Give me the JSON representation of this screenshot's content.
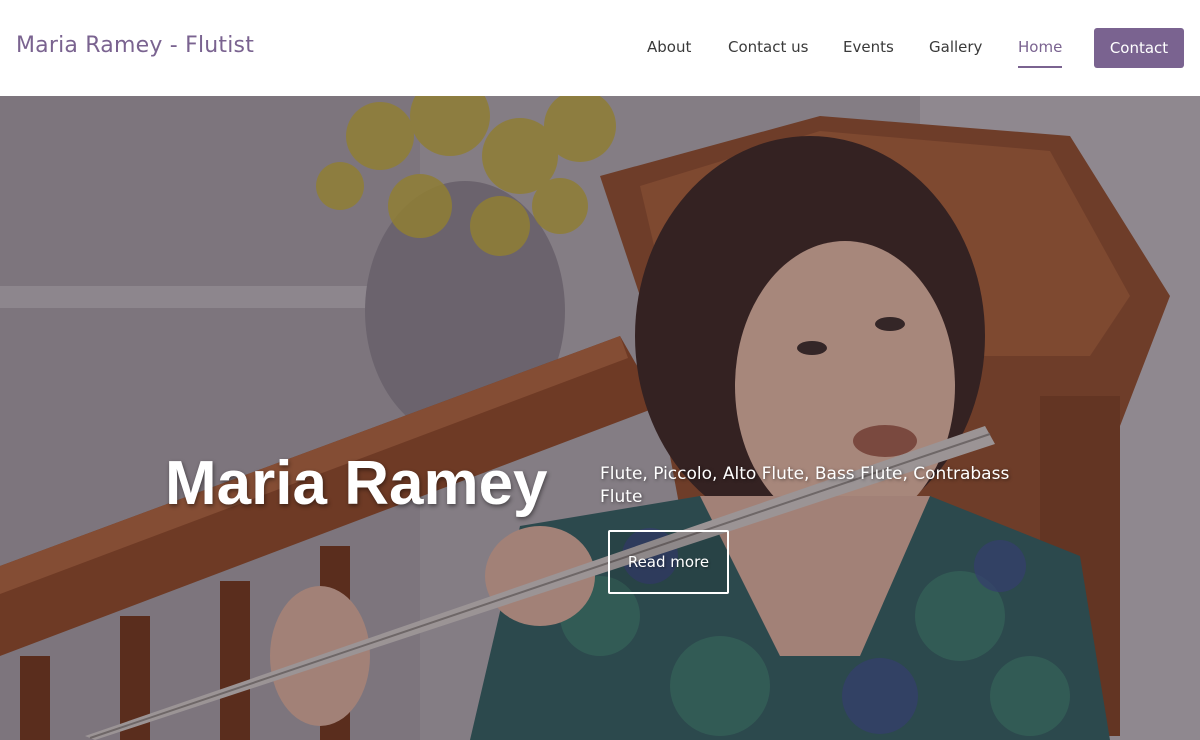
{
  "header": {
    "site_title": "Maria Ramey - Flutist",
    "nav": [
      {
        "label": "About"
      },
      {
        "label": "Contact us"
      },
      {
        "label": "Events"
      },
      {
        "label": "Gallery"
      },
      {
        "label": "Home",
        "active": true
      }
    ],
    "contact_button": "Contact"
  },
  "hero": {
    "title": "Maria Ramey",
    "subtitle": "Flute, Piccolo, Alto Flute, Bass Flute, Contrabass Flute",
    "read_more": "Read more"
  },
  "colors": {
    "accent": "#7a6390",
    "header_bg": "#ffffff",
    "hero_text": "#ffffff"
  }
}
